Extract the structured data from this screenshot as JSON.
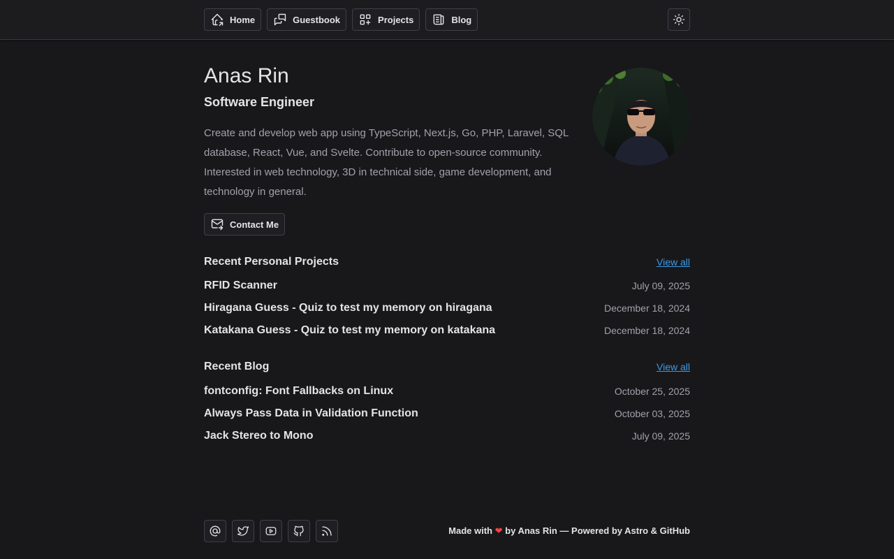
{
  "nav": {
    "home": "Home",
    "guestbook": "Guestbook",
    "projects": "Projects",
    "blog": "Blog"
  },
  "profile": {
    "name": "Anas Rin",
    "role": "Software Engineer",
    "bio": "Create and develop web app using TypeScript, Next.js, Go, PHP, Laravel, SQL database, React, Vue, and Svelte. Contribute to open-source community. Interested in web technology, 3D in technical side, game development, and technology in general.",
    "contact_label": "Contact Me"
  },
  "projects": {
    "title": "Recent Personal Projects",
    "view_all": "View all",
    "items": [
      {
        "title": "RFID Scanner",
        "date": "July 09, 2025"
      },
      {
        "title": "Hiragana Guess - Quiz to test my memory on hiragana",
        "date": "December 18, 2024"
      },
      {
        "title": "Katakana Guess - Quiz to test my memory on katakana",
        "date": "December 18, 2024"
      }
    ]
  },
  "blog": {
    "title": "Recent Blog",
    "view_all": "View all",
    "items": [
      {
        "title": "fontconfig: Font Fallbacks on Linux",
        "date": "October 25, 2025"
      },
      {
        "title": "Always Pass Data in Validation Function",
        "date": "October 03, 2025"
      },
      {
        "title": "Jack Stereo to Mono",
        "date": "July 09, 2025"
      }
    ]
  },
  "footer": {
    "made_with": "Made with",
    "heart": "❤",
    "rest": "by Anas Rin — Powered by Astro & GitHub"
  },
  "colors": {
    "background": "#18181b",
    "link": "#3b9be8",
    "heart": "#ef4444"
  }
}
